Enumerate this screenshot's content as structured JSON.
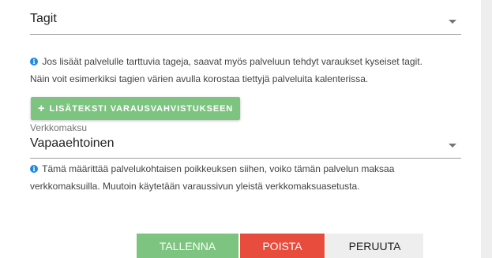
{
  "tags": {
    "value": "Tagit"
  },
  "tags_info": "Jos lisäät palvelulle tarttuvia tageja, saavat myös palveluun tehdyt varaukset kyseiset tagit.",
  "tags_info_2": "Näin voit esimerkiksi tagien värien avulla korostaa tiettyjä palveluita kalenterissa.",
  "add_text_button": {
    "icon": "+",
    "label": "LISÄTEKSTI VARAUSVAHVISTUKSEEN"
  },
  "payment": {
    "label": "Verkkomaksu",
    "value": "Vapaaehtoinen"
  },
  "payment_info": "Tämä määrittää palvelukohtaisen poikkeuksen siihen, voiko tämän palvelun maksaa",
  "payment_info_2": "verkkomaksuilla. Muutoin käytetään varaussivun yleistä verkkomaksuasetusta.",
  "actions": {
    "save": "TALLENNA",
    "delete": "POISTA",
    "cancel": "PERUUTA"
  },
  "colors": {
    "accent_green": "#7cc47f",
    "danger_red": "#e74c3c",
    "info_blue": "#1e88e5"
  }
}
